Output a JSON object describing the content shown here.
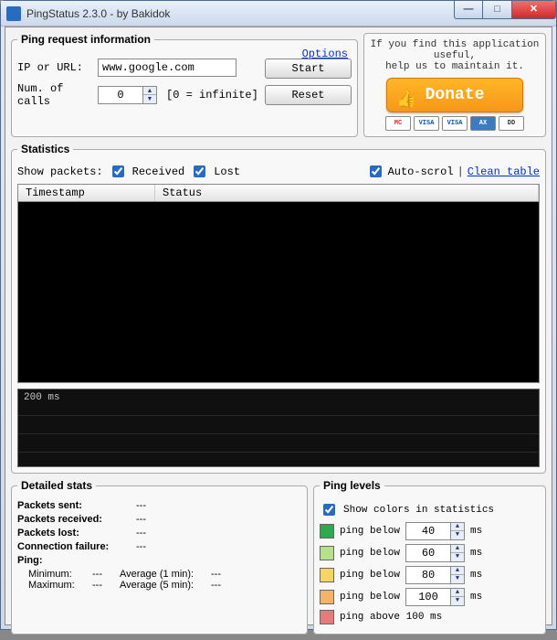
{
  "window": {
    "title": "PingStatus 2.3.0 - by Bakidok"
  },
  "request": {
    "legend": "Ping request information",
    "options_link": "Options",
    "ip_label": "IP or URL:",
    "ip_value": "www.google.com",
    "num_label": "Num. of calls",
    "num_value": "0",
    "num_hint": "[0 = infinite]",
    "start_btn": "Start",
    "reset_btn": "Reset"
  },
  "donate": {
    "line1": "If you find this application useful,",
    "line2": "help us to maintain it.",
    "button": "Donate"
  },
  "stats": {
    "legend": "Statistics",
    "show_label": "Show packets:",
    "received": "Received",
    "lost": "Lost",
    "autoscroll": "Auto-scrol",
    "clear": "Clean table",
    "col_timestamp": "Timestamp",
    "col_status": "Status",
    "graph_label": "200 ms"
  },
  "detailed": {
    "legend": "Detailed stats",
    "sent_k": "Packets sent:",
    "sent_v": "---",
    "recv_k": "Packets received:",
    "recv_v": "---",
    "lost_k": "Packets lost:",
    "lost_v": "---",
    "fail_k": "Connection failure:",
    "fail_v": "---",
    "ping_k": "Ping:",
    "min_k": "Minimum:",
    "min_v": "---",
    "max_k": "Maximum:",
    "max_v": "---",
    "avg1_k": "Average (1 min):",
    "avg1_v": "---",
    "avg5_k": "Average (5 min):",
    "avg5_v": "---"
  },
  "levels": {
    "legend": "Ping levels",
    "show_colors": "Show colors in statistics",
    "below": "ping below",
    "above": "ping above 100 ms",
    "ms": "ms",
    "thresholds": [
      "40",
      "60",
      "80",
      "100"
    ],
    "colors": [
      "#2fa84f",
      "#b7e08a",
      "#f6d565",
      "#f6b26b",
      "#e77a7a"
    ]
  }
}
